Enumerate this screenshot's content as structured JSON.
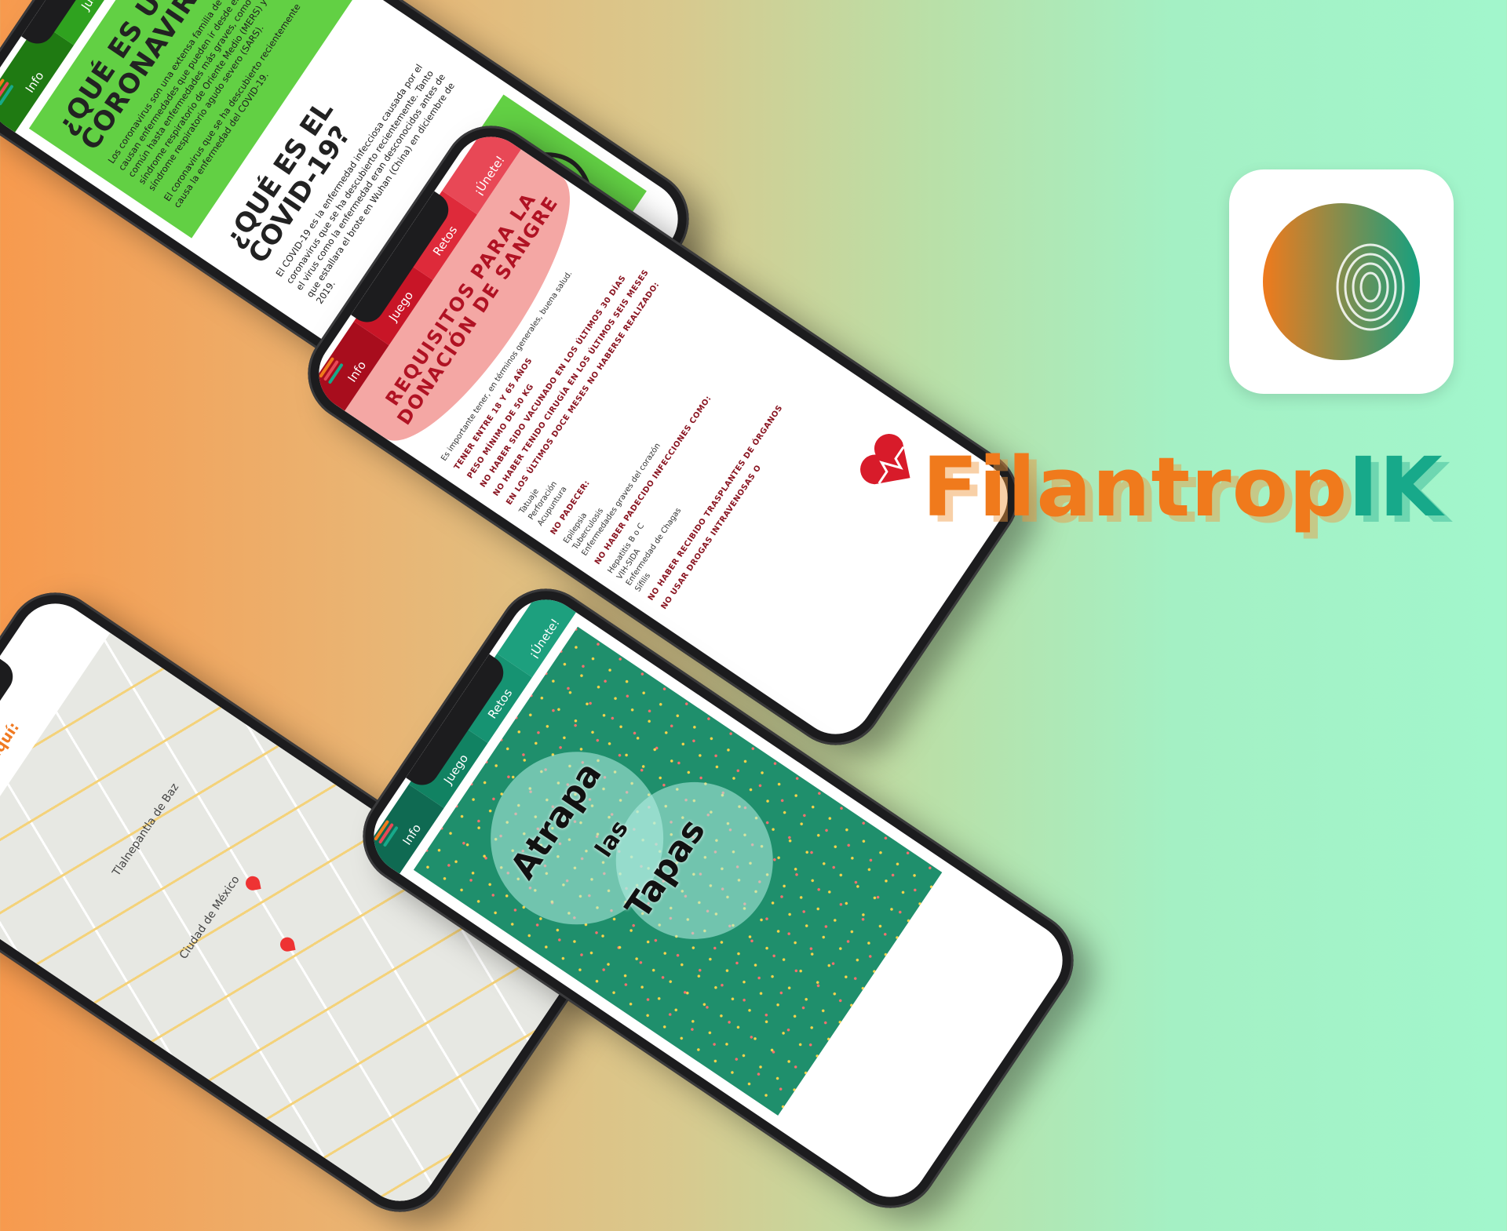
{
  "brand": {
    "name_main": "Filantrop",
    "name_suffix": "IK"
  },
  "colors": {
    "accent_orange": "#f07a1c",
    "accent_teal": "#17a98a"
  },
  "phone_covid": {
    "tabs": [
      "Info",
      "Juego",
      ""
    ],
    "section1_title": "¿QUÉ ES UN CORONAVIRUS?",
    "section1_p1": "Los coronavirus son una extensa familia de virus que causan enfermedades que pueden ir desde el resfriado común hasta enfermedades más graves, como el síndrome respiratorio de Oriente Medio (MERS) y el síndrome respiratorio agudo severo (SARS).",
    "section1_p2": "El coronavirus que se ha descubierto recientemente causa la enfermedad del COVID-19.",
    "section2_title": "¿QUÉ ES EL COVID-19?",
    "section2_p1": "El COVID-19 es la enfermedad infecciosa causada por el coronavirus que se ha descubierto recientemente. Tanto el virus como la enfermedad eran desconocidos antes de que estallara el brote en Wuhan (China) en diciembre de 2019."
  },
  "phone_blood": {
    "tabs": [
      "Info",
      "Juego",
      "Retos",
      "¡Únete!"
    ],
    "title": "REQUISITOS PARA LA DONACIÓN DE SANGRE",
    "intro": "Es importante tener, en términos generales, buena salud.",
    "items": [
      "TENER ENTRE 18 Y 65 AÑOS",
      "PESO MÍNIMO DE 50 KG",
      "NO HABER SIDO VACUNADO EN LOS ÚLTIMOS 30 DÍAS",
      "NO HABER TENIDO CIRUGÍA EN LOS ÚLTIMOS SEIS MESES",
      "EN LOS ÚLTIMOS DOCE MESES NO HABERSE REALIZADO:",
      "NO PADECER:",
      "NO HABER PADECIDO INFECCIONES COMO:",
      "NO HABER RECIBIDO TRASPLANTES DE ÓRGANOS",
      "NO USAR DROGAS INTRAVENOSAS O"
    ],
    "list_tattoo": [
      "Tatuaje",
      "Perforación",
      "Acupuntura"
    ],
    "list_diseases": [
      "Epilepsia",
      "Tuberculosis",
      "Enfermedades graves del corazón"
    ],
    "list_infections": [
      "Hepatitis B o C",
      "VIH-SIDA",
      "Enfermedad de Chagas",
      "Sífilis"
    ]
  },
  "phone_map": {
    "header": "Dona tu trenza aquí:",
    "labels": [
      "Tlalnepantla de Baz",
      "Ciudad de México"
    ]
  },
  "phone_game": {
    "tabs": [
      "Info",
      "Juego",
      "Retos",
      "¡Únete!"
    ],
    "title_words": [
      "Atrapa",
      "las",
      "Tapas"
    ]
  },
  "icons": [
    "fingerprint-icon",
    "back-arrow-icon",
    "map-pin-icon"
  ]
}
